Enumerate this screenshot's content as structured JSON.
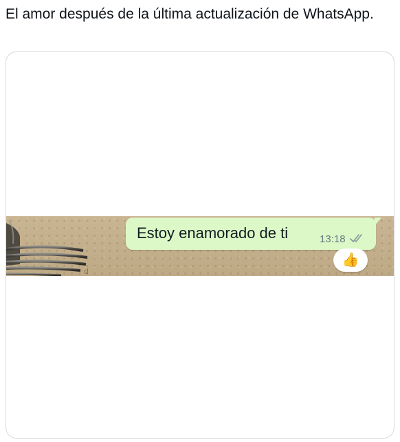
{
  "tweet": {
    "text": "El amor después de la última actualización de WhatsApp."
  },
  "chat": {
    "message": "Estoy enamorado de ti",
    "time": "13:18",
    "status_icon": "double-check-icon",
    "reaction": "👍",
    "colors": {
      "bubble": "#dcf8c6",
      "wallpaper": "#c4b08c",
      "time": "#667781"
    }
  }
}
